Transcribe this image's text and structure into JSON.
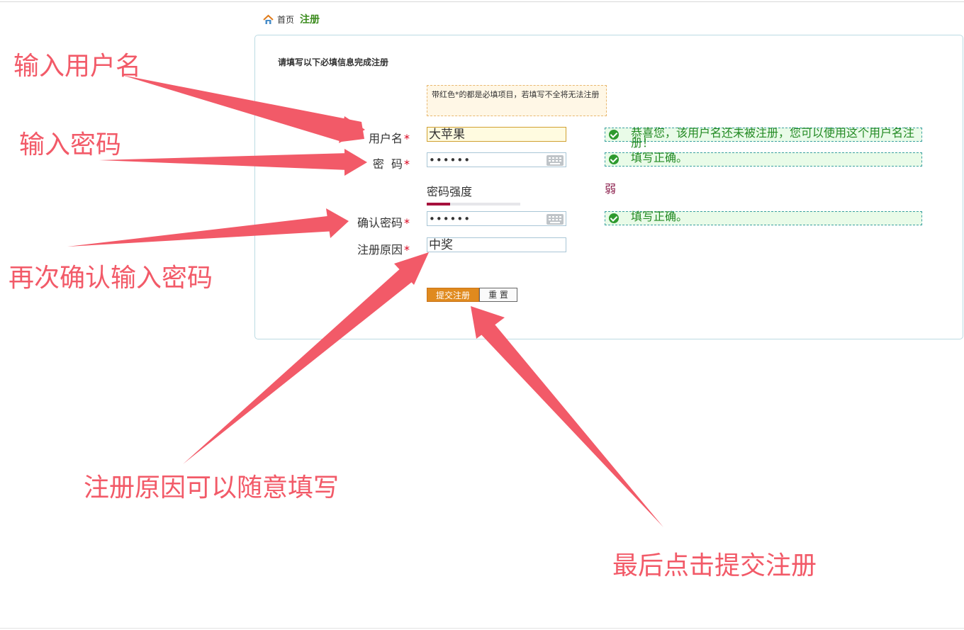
{
  "breadcrumb": {
    "home": "首页",
    "current": "注册"
  },
  "form": {
    "title": "请填写以下必填信息完成注册",
    "notice": "带红色*的都是必填项目，若填写不全将无法注册",
    "username": {
      "label": "用户名",
      "required": "*",
      "value": "大苹果",
      "tip": "恭喜您，该用户名还未被注册，您可以使用这个用户名注册！"
    },
    "password": {
      "label": "密  码",
      "required": "*",
      "value": "••••••",
      "tip": "填写正确。"
    },
    "strength": {
      "label": "密码强度",
      "value": "弱",
      "level": 0.25
    },
    "confirm": {
      "label": "确认密码",
      "required": "*",
      "value": "••••••",
      "tip": "填写正确。"
    },
    "reason": {
      "label": "注册原因",
      "required": "*",
      "value": "中奖"
    },
    "submit_label": "提交注册",
    "reset_label": "重 置"
  },
  "annotations": {
    "username": "输入用户名",
    "password": "输入密码",
    "confirm": "再次确认输入密码",
    "reason": "注册原因可以随意填写",
    "submit": "最后点击提交注册"
  },
  "colors": {
    "accent": "#e08a1e",
    "success": "#238a23",
    "annotation": "#f25a68",
    "required": "#d9001b"
  }
}
